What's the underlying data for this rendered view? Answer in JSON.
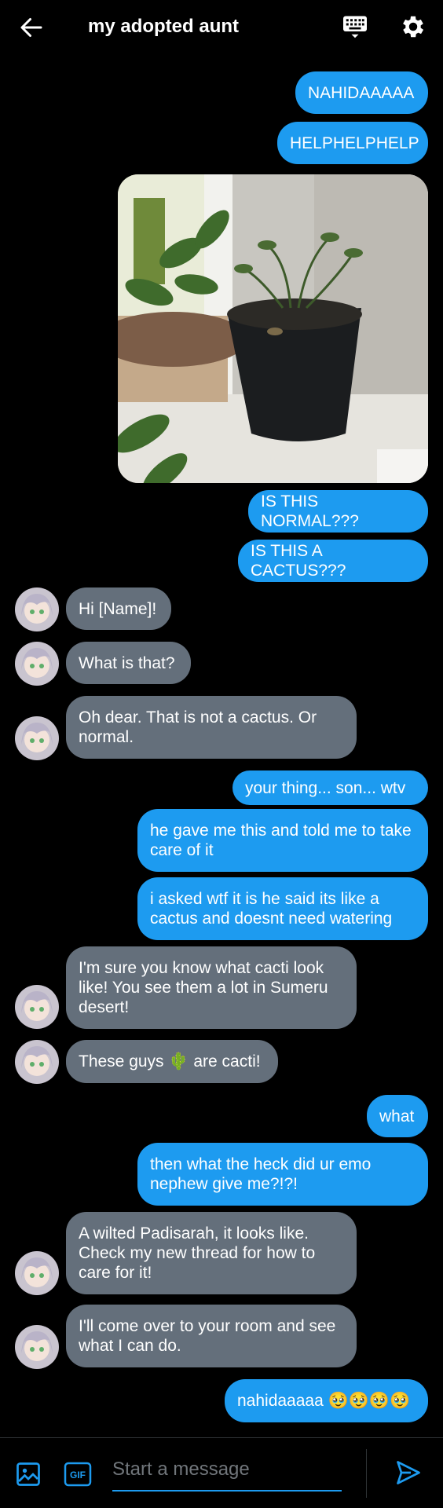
{
  "header": {
    "title": "my adopted aunt",
    "back_icon": "arrow-left-icon",
    "keyboard_icon": "keyboard-icon",
    "settings_icon": "gear-icon"
  },
  "messages": [
    {
      "from": "me",
      "text": "NAHIDAAAAA"
    },
    {
      "from": "me",
      "text": "HELPHELPHELP"
    },
    {
      "from": "me",
      "type": "photo",
      "image": "photo of a wilted potted plant on a windowsill"
    },
    {
      "from": "me",
      "text": "IS THIS NORMAL???"
    },
    {
      "from": "me",
      "text": "IS THIS A CACTUS???"
    },
    {
      "from": "them",
      "text": "Hi [Name]!"
    },
    {
      "from": "them",
      "text": "What is that?"
    },
    {
      "from": "them",
      "text": "Oh dear. That is not a cactus. Or normal."
    },
    {
      "from": "me",
      "text": "your thing... son... wtv"
    },
    {
      "from": "me",
      "text": "he gave me this and told me to take care of it"
    },
    {
      "from": "me",
      "text": "i asked wtf it is he said its like a cactus and doesnt need watering"
    },
    {
      "from": "them",
      "text": "I'm sure you know what cacti look like! You see them a lot in Sumeru desert!"
    },
    {
      "from": "them",
      "text": "These guys 🌵 are cacti!"
    },
    {
      "from": "me",
      "text": "what"
    },
    {
      "from": "me",
      "text": "then what the heck did ur emo nephew give me?!?!"
    },
    {
      "from": "them",
      "text": "A wilted Padisarah, it looks like. Check my new thread for how to care for it!"
    },
    {
      "from": "them",
      "text": "I'll come over to your room and see what I can do."
    },
    {
      "from": "me",
      "text": "nahidaaaaa 🥹🥹🥹🥹"
    }
  ],
  "composer": {
    "placeholder": "Start a message",
    "image_icon": "image-icon",
    "gif_label": "GIF",
    "send_icon": "send-icon"
  },
  "colors": {
    "sent_bubble": "#1d9bf0",
    "received_bubble": "#646f7b",
    "background": "#000000",
    "accent": "#1d9bf0"
  }
}
